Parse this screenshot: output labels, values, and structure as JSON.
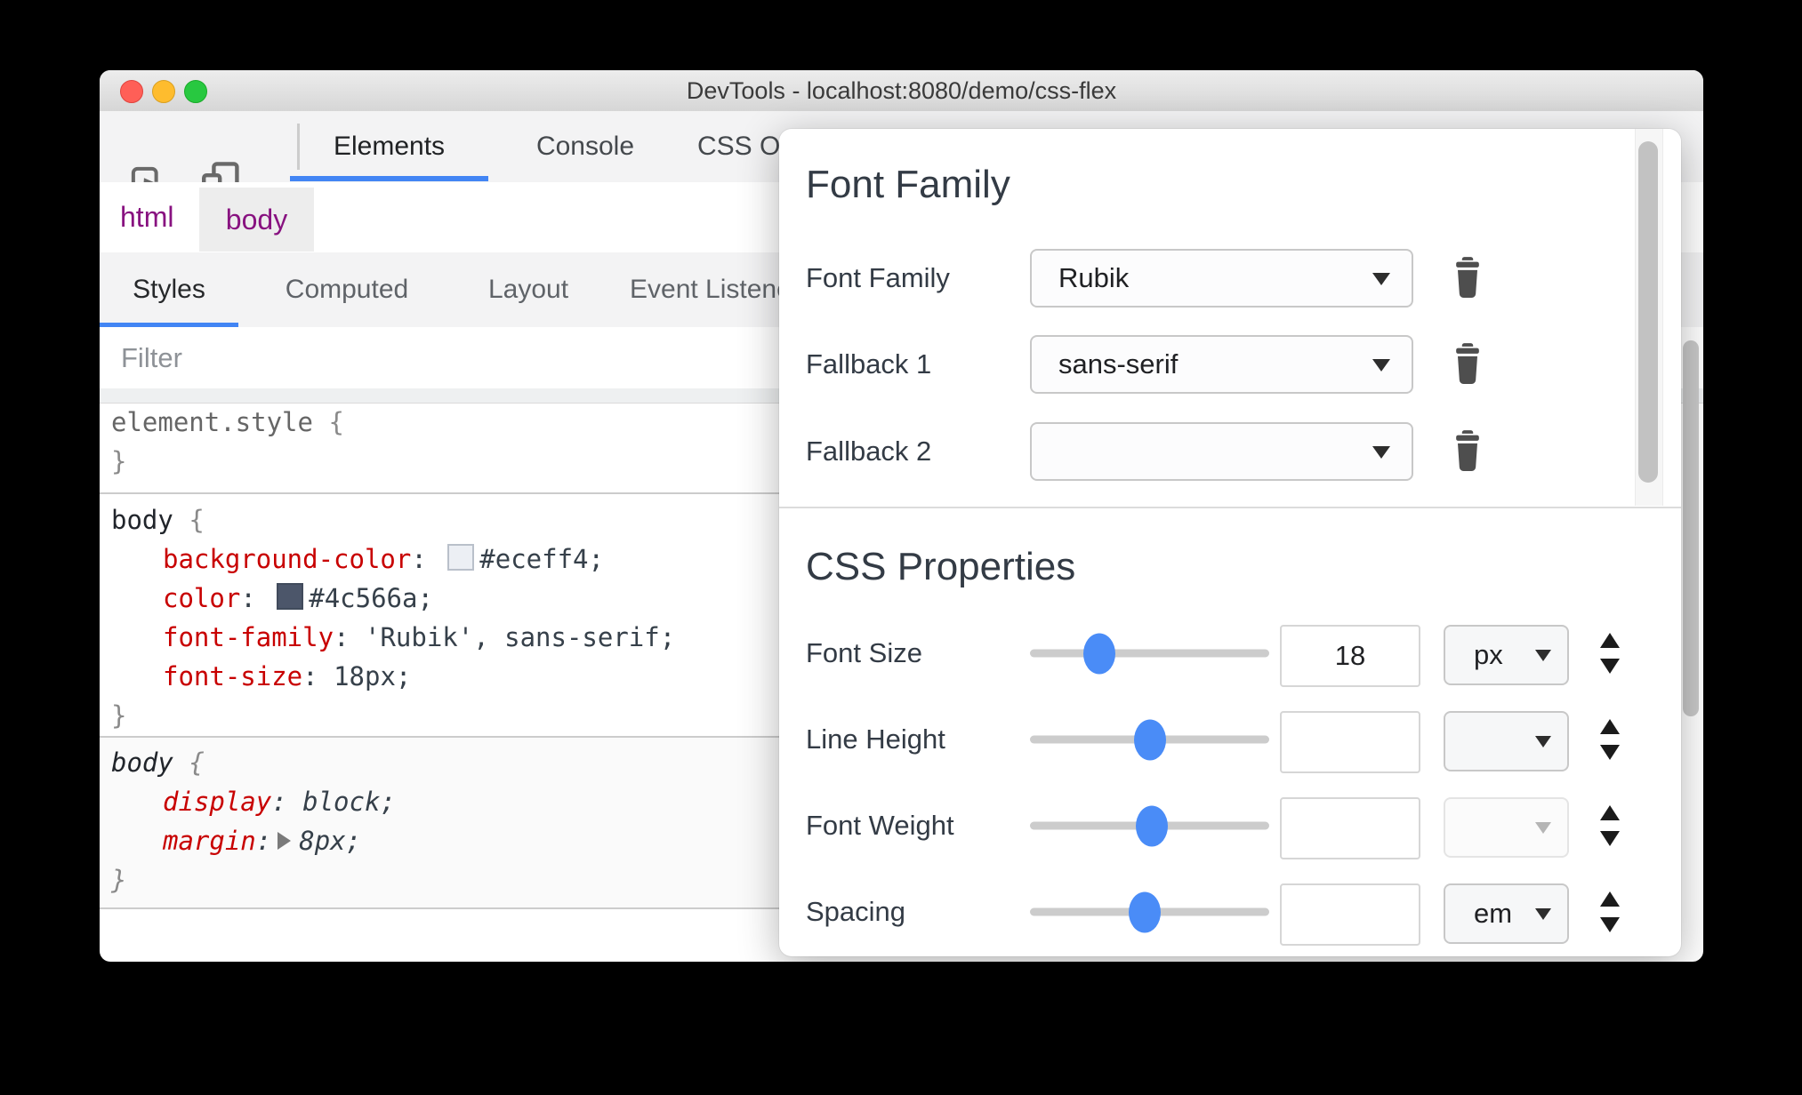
{
  "window": {
    "title": "DevTools - localhost:8080/demo/css-flex"
  },
  "toolbar": {
    "tabs": [
      {
        "label": "Elements",
        "active": true
      },
      {
        "label": "Console",
        "active": false
      },
      {
        "label": "CSS Overview",
        "active": false
      }
    ]
  },
  "breadcrumb": {
    "items": [
      {
        "label": "html",
        "selected": false
      },
      {
        "label": "body",
        "selected": true
      }
    ]
  },
  "styles_pane": {
    "tabs": [
      {
        "label": "Styles",
        "active": true
      },
      {
        "label": "Computed",
        "active": false
      },
      {
        "label": "Layout",
        "active": false
      },
      {
        "label": "Event Listeners",
        "active": false
      }
    ],
    "filter": {
      "placeholder": "Filter"
    },
    "syntax": {
      "open_brace": "{",
      "close_brace": "}",
      "separator": ": "
    },
    "rules": [
      {
        "selector": "element.style",
        "declarations": []
      },
      {
        "selector": "body",
        "declarations": [
          {
            "property": "background-color",
            "value": "#eceff4;",
            "swatch": "#eceff4"
          },
          {
            "property": "color",
            "value": "#4c566a;",
            "swatch": "#4c566a"
          },
          {
            "property": "font-family",
            "value": "'Rubik', sans-serif;"
          },
          {
            "property": "font-size",
            "value": "18px;"
          }
        ]
      },
      {
        "selector": "body",
        "user_agent": true,
        "declarations": [
          {
            "property": "display",
            "value": "block;"
          },
          {
            "property": "margin",
            "value": "8px;",
            "expandable": true
          }
        ]
      }
    ]
  },
  "font_editor": {
    "font_family_section": {
      "title": "Font Family",
      "rows": [
        {
          "label": "Font Family",
          "value": "Rubik"
        },
        {
          "label": "Fallback 1",
          "value": "sans-serif"
        },
        {
          "label": "Fallback 2",
          "value": ""
        }
      ]
    },
    "css_properties_section": {
      "title": "CSS Properties",
      "rows": [
        {
          "label": "Font Size",
          "value": "18",
          "unit": "px",
          "slider_pct": 29,
          "unit_enabled": true
        },
        {
          "label": "Line Height",
          "value": "",
          "unit": "",
          "slider_pct": 50,
          "unit_enabled": true
        },
        {
          "label": "Font Weight",
          "value": "",
          "unit": "",
          "slider_pct": 51,
          "unit_enabled": false
        },
        {
          "label": "Spacing",
          "value": "",
          "unit": "em",
          "slider_pct": 48,
          "unit_enabled": true
        }
      ]
    }
  },
  "colors": {
    "accent_blue": "#4285f4",
    "slider_thumb_blue": "#4a8cf7",
    "property_red": "#c80000",
    "value_dark": "#36404a",
    "breadcrumb_purple": "#881280",
    "background_swatch": "#eceff4",
    "color_swatch": "#4c566a"
  }
}
